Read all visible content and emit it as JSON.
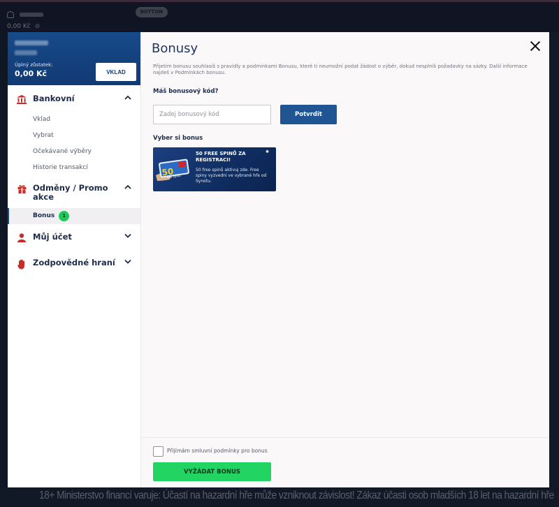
{
  "background": {
    "balance": "0,00 Kč",
    "button_label": "BUTTON",
    "warning": "18+ Ministerstvo financí varuje: Účastí na hazardní hře může vzniknout závislost! Zákaz účasti osob mladších 18 let na hazardní hře"
  },
  "sidebar": {
    "balance_label": "Úplný zůstatek:",
    "balance_value": "0,00 Kč",
    "deposit_button": "VKLAD",
    "sections": [
      {
        "title": "Bankovní",
        "icon": "bank-icon",
        "expanded": true,
        "items": [
          "Vklad",
          "Vybrat",
          "Očekávané výběry",
          "Historie transakcí"
        ]
      },
      {
        "title": "Odměny / Promo akce",
        "icon": "gift-icon",
        "expanded": true,
        "items": [
          {
            "label": "Bonus",
            "badge": "1",
            "active": true
          }
        ]
      },
      {
        "title": "Můj účet",
        "icon": "user-icon",
        "expanded": false
      },
      {
        "title": "Zodpovědné hraní",
        "icon": "hand-icon",
        "expanded": false
      }
    ]
  },
  "main": {
    "title": "Bonusy",
    "terms": "Přijetím bonusu souhlasíš s pravidly a podmínkami Bonusu, které ti neumožní podat žádost o výběr, dokud nesplníš požadavky na sázky. Další informace najdeš v Podmínkách bonusu.",
    "code_label": "Máš bonusový kód?",
    "code_placeholder": "Zadej bonusový kód",
    "confirm_button": "Potvrdit",
    "choose_label": "Vyber si bonus",
    "bonus_card": {
      "title": "50 FREE SPINŮ ZA REGISTRACI!",
      "description": "50 free spinů aktivuj zde. Free spiny vyzvedni ve vybrané hře od Synotu.",
      "art_number": "50",
      "art_caption": "free spinů"
    },
    "accept_label": "Přijímám smluvní podmínky pro bonus",
    "claim_button": "VYŽÁDAT BONUS"
  },
  "colors": {
    "brand_blue": "#1e5592",
    "accent_green": "#22d562",
    "icon_red": "#c62e2b"
  }
}
